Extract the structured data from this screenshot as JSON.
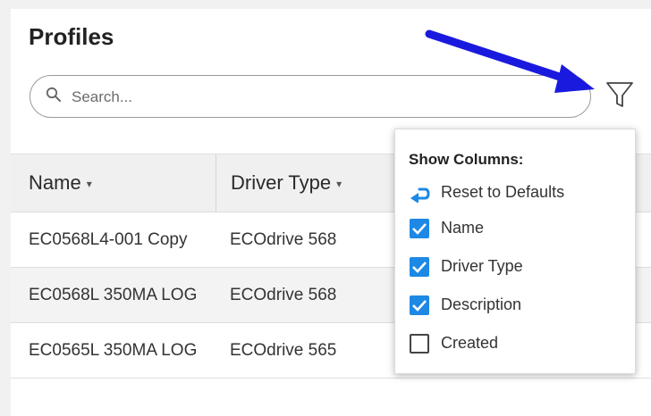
{
  "page": {
    "title": "Profiles"
  },
  "search": {
    "placeholder": "Search..."
  },
  "table": {
    "columns": [
      {
        "label": "Name",
        "caret": "▾"
      },
      {
        "label": "Driver Type",
        "caret": "▾"
      }
    ],
    "rows": [
      {
        "name": "EC0568L4-001 Copy",
        "driver": "ECOdrive 568"
      },
      {
        "name": "EC0568L 350MA LOG",
        "driver": "ECOdrive 568"
      },
      {
        "name": "EC0565L 350MA LOG",
        "driver": "ECOdrive 565"
      }
    ]
  },
  "column_menu": {
    "title": "Show Columns:",
    "reset_label": "Reset to Defaults",
    "options": [
      {
        "label": "Name",
        "checked": true
      },
      {
        "label": "Driver Type",
        "checked": true
      },
      {
        "label": "Description",
        "checked": true
      },
      {
        "label": "Created",
        "checked": false
      }
    ]
  },
  "icons": {
    "search": "search-icon",
    "filter": "filter-funnel-icon",
    "reset": "reset-arrow-icon",
    "annotation": "blue-annotation-arrow"
  },
  "colors": {
    "accent": "#1e88e5",
    "annotation_arrow": "#1a1adf",
    "header_bg": "#f0f0f0",
    "alt_row_bg": "#f3f3f3"
  }
}
